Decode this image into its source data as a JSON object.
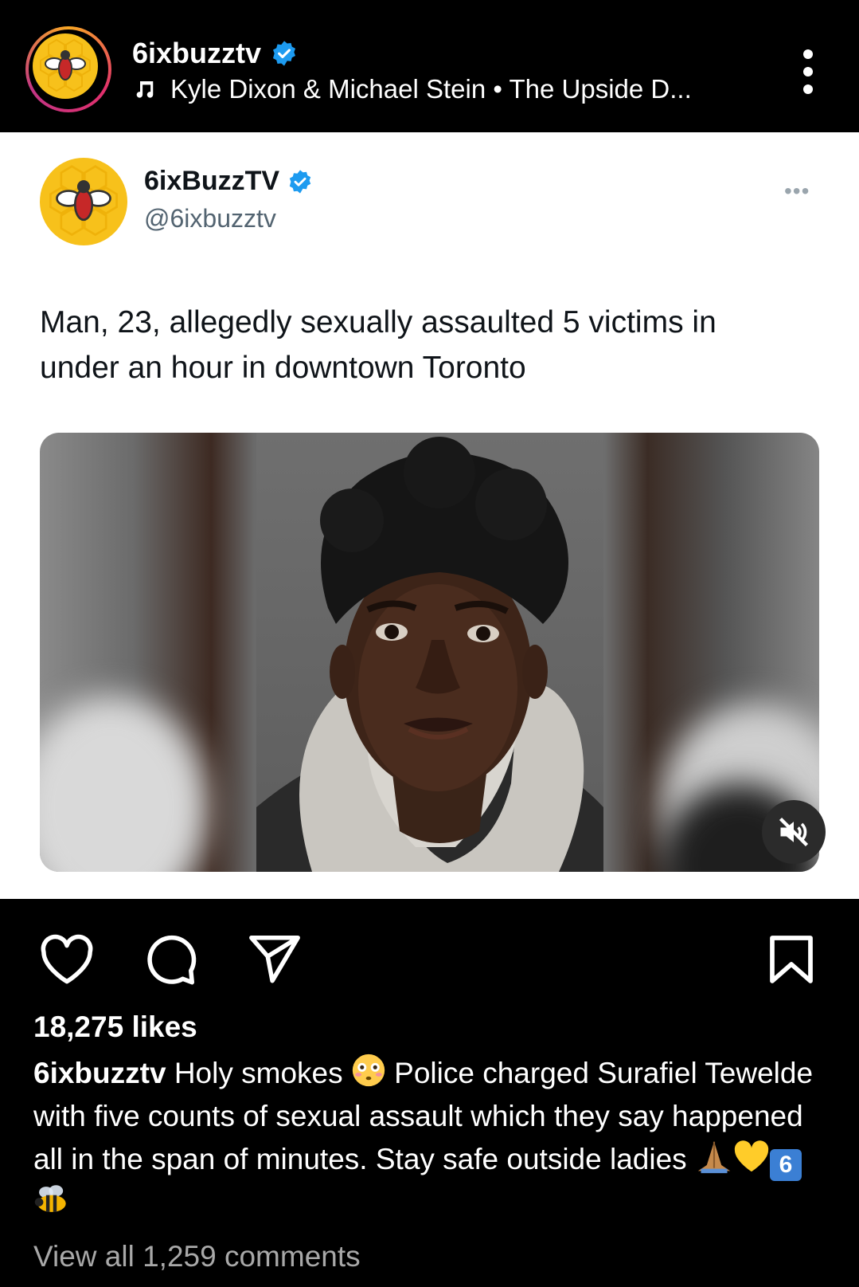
{
  "header": {
    "username": "6ixbuzztv",
    "music_icon": "music-note-icon",
    "music_text": "Kyle Dixon & Michael Stein • The Upside D...",
    "more_icon": "vertical-dots-icon"
  },
  "tweet": {
    "display_name": "6ixBuzzTV",
    "handle": "@6ixbuzztv",
    "more_text": "•••",
    "text": "Man, 23, allegedly sexually assaulted 5 victims in under an hour in downtown Toronto",
    "media_icon": "muted-speaker-icon"
  },
  "actions": {
    "like_icon": "heart-icon",
    "comment_icon": "comment-icon",
    "share_icon": "send-icon",
    "save_icon": "bookmark-icon"
  },
  "post": {
    "likes": "18,275 likes",
    "caption_user": "6ixbuzztv",
    "caption_part1": " Holy smokes ",
    "caption_part2": " Police charged Surafiel Tewelde with five counts of sexual assault which they say happened all in the span of minutes. Stay safe outside ladies ",
    "caption_emojis": [
      "flushed-face",
      "folded-hands",
      "yellow-heart",
      "keycap-6",
      "bee"
    ],
    "keycap_text": "6",
    "view_comments": "View all 1,259 comments"
  },
  "colors": {
    "verified_blue": "#1d9bf0",
    "logo_yellow": "#f7c11b"
  }
}
